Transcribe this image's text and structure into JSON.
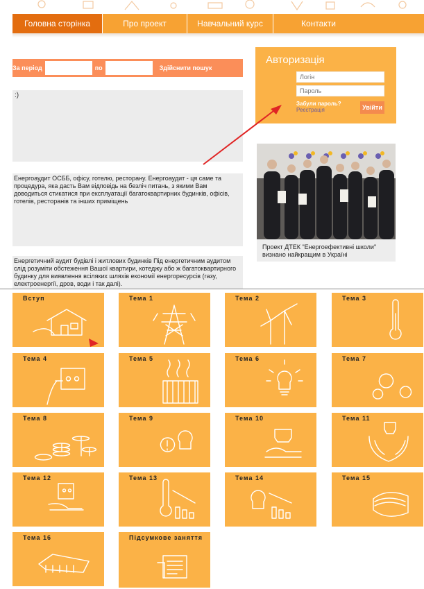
{
  "nav": {
    "items": [
      "Головна сторінка",
      "Про проект",
      "Навчальний курс",
      "Контакти"
    ]
  },
  "search": {
    "period_label": "За період",
    "to_label": "по",
    "submit_label": "Здійснити пошук"
  },
  "news": {
    "smiley": ":)",
    "text1": "Енергоаудит ОСББ, офісу, готелю, ресторану. Енергоаудит - ця саме та процедура, яка дасть Вам відповідь на безліч питань, з якими Вам доводиться стикатися при експлуатації багатоквартирних будинків, офісів, готелів, ресторанів та інших приміщень",
    "text2": "Енергетичний аудит будівлі і житлових будинків Під енергетичним аудитом слід розуміти обстеження Вашої квартири, котеджу або ж багатоквартирного будинку для виявлення всіляких шляхів економії енергоресурсів (газу, електроенергії, дров, води і так далі)."
  },
  "auth": {
    "title": "Авторизація",
    "login_placeholder": "Логін",
    "password_placeholder": "Пароль",
    "forgot": "Забули пароль?",
    "register": "Реєстрація",
    "enter": "Увійти"
  },
  "photo": {
    "caption": "Проект ДТЕК \"Енергоефективні школи\" визнано найкращим в Україні"
  },
  "tiles": [
    {
      "title": "Вступ",
      "icon": "house-icon"
    },
    {
      "title": "Тема 1",
      "icon": "power-tower-icon"
    },
    {
      "title": "Тема 2",
      "icon": "wind-turbine-icon"
    },
    {
      "title": "Тема 3",
      "icon": "thermometer-icon"
    },
    {
      "title": "Тема 4",
      "icon": "socket-plug-icon"
    },
    {
      "title": "Тема 5",
      "icon": "radiator-icon"
    },
    {
      "title": "Тема 6",
      "icon": "bulb-icon"
    },
    {
      "title": "Тема 7",
      "icon": "gears-icon"
    },
    {
      "title": "Тема 8",
      "icon": "coins-icon"
    },
    {
      "title": "Тема 9",
      "icon": "bulb-info-icon"
    },
    {
      "title": "Тема 10",
      "icon": "bulb-hand-icon"
    },
    {
      "title": "Тема 11",
      "icon": "hands-bulb-icon"
    },
    {
      "title": "Тема 12",
      "icon": "hand-socket-icon"
    },
    {
      "title": "Тема 13",
      "icon": "thermometer-chart-icon"
    },
    {
      "title": "Тема 14",
      "icon": "bulb-chart-icon"
    },
    {
      "title": "Тема 15",
      "icon": "pipe-insulation-icon"
    },
    {
      "title": "Тема 16",
      "icon": "building-icon"
    },
    {
      "title": "Підсумкове заняття",
      "icon": "document-icon"
    }
  ],
  "colors": {
    "nav": "#f7a233",
    "nav_active": "#e36d0f",
    "tile": "#fbb247",
    "search_bar": "#fb8e59",
    "arrow": "#e02424"
  }
}
